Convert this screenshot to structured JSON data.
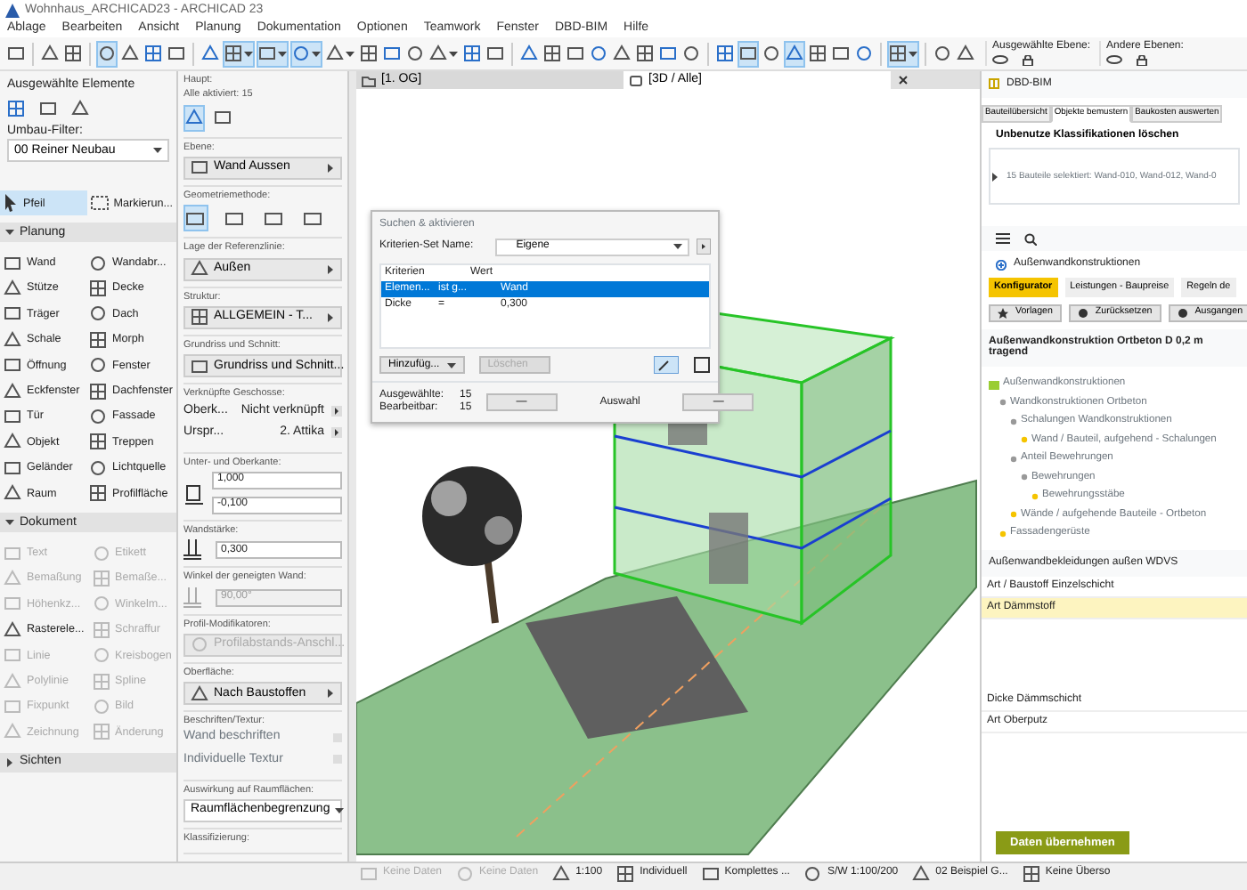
{
  "window": {
    "title": "Wohnhaus_ARCHICAD23 - ARCHICAD 23"
  },
  "menu": [
    "Ablage",
    "Bearbeiten",
    "Ansicht",
    "Planung",
    "Dokumentation",
    "Optionen",
    "Teamwork",
    "Fenster",
    "DBD-BIM",
    "Hilfe"
  ],
  "toolbar": {
    "items": [
      {
        "kind": "button",
        "selected": false
      },
      {
        "kind": "separator"
      },
      {
        "kind": "button",
        "selected": false
      },
      {
        "kind": "button",
        "selected": false
      },
      {
        "kind": "separator"
      },
      {
        "kind": "button",
        "selected": true
      },
      {
        "kind": "button",
        "selected": false
      },
      {
        "kind": "button",
        "selected": false
      },
      {
        "kind": "button",
        "selected": false
      },
      {
        "kind": "separator"
      },
      {
        "kind": "button",
        "selected": false
      },
      {
        "kind": "dropdown",
        "selected": true
      },
      {
        "kind": "dropdown",
        "selected": true
      },
      {
        "kind": "dropdown",
        "selected": true
      },
      {
        "kind": "dropdown",
        "selected": false
      },
      {
        "kind": "button",
        "selected": false
      },
      {
        "kind": "button",
        "selected": false
      },
      {
        "kind": "button",
        "selected": false
      },
      {
        "kind": "dropdown",
        "selected": false
      },
      {
        "kind": "button",
        "selected": false
      },
      {
        "kind": "button",
        "selected": false
      },
      {
        "kind": "separator"
      },
      {
        "kind": "button",
        "selected": false
      },
      {
        "kind": "button",
        "selected": false
      },
      {
        "kind": "button",
        "selected": false
      },
      {
        "kind": "button",
        "selected": false
      },
      {
        "kind": "button",
        "selected": false
      },
      {
        "kind": "button",
        "selected": false
      },
      {
        "kind": "button",
        "selected": false
      },
      {
        "kind": "button",
        "selected": false
      },
      {
        "kind": "separator"
      },
      {
        "kind": "button",
        "selected": false
      },
      {
        "kind": "button",
        "selected": true
      },
      {
        "kind": "button",
        "selected": false
      },
      {
        "kind": "button",
        "selected": true
      },
      {
        "kind": "button",
        "selected": false
      },
      {
        "kind": "button",
        "selected": false
      },
      {
        "kind": "button",
        "selected": false
      },
      {
        "kind": "separator"
      },
      {
        "kind": "dropdown",
        "selected": true
      },
      {
        "kind": "separator"
      },
      {
        "kind": "button",
        "selected": false
      },
      {
        "kind": "button",
        "selected": false
      }
    ],
    "layers": [
      "Ausgewählte Ebene:",
      "Andere Ebenen:"
    ]
  },
  "toolbox": {
    "title": "Ausgewählte Elemente",
    "filter_label": "Umbau-Filter:",
    "filter_value": "00 Reiner Neubau",
    "pointer_tools": [
      {
        "label": "Pfeil",
        "selected": true
      },
      {
        "label": "Markierun...",
        "selected": false
      }
    ],
    "groups": [
      {
        "label": "Planung",
        "expanded": true,
        "tools": [
          {
            "label": "Wand",
            "disabled": false
          },
          {
            "label": "Wandabr...",
            "disabled": false
          },
          {
            "label": "Stütze",
            "disabled": false
          },
          {
            "label": "Decke",
            "disabled": false
          },
          {
            "label": "Träger",
            "disabled": false
          },
          {
            "label": "Dach",
            "disabled": false
          },
          {
            "label": "Schale",
            "disabled": false
          },
          {
            "label": "Morph",
            "disabled": false
          },
          {
            "label": "Öffnung",
            "disabled": false
          },
          {
            "label": "Fenster",
            "disabled": false
          },
          {
            "label": "Eckfenster",
            "disabled": false
          },
          {
            "label": "Dachfenster",
            "disabled": false
          },
          {
            "label": "Tür",
            "disabled": false
          },
          {
            "label": "Fassade",
            "disabled": false
          },
          {
            "label": "Objekt",
            "disabled": false
          },
          {
            "label": "Treppen",
            "disabled": false
          },
          {
            "label": "Geländer",
            "disabled": false
          },
          {
            "label": "Lichtquelle",
            "disabled": false
          },
          {
            "label": "Raum",
            "disabled": false
          },
          {
            "label": "Profilfläche",
            "disabled": false
          }
        ]
      },
      {
        "label": "Dokument",
        "expanded": true,
        "tools": [
          {
            "label": "Text",
            "disabled": true
          },
          {
            "label": "Etikett",
            "disabled": true
          },
          {
            "label": "Bemaßung",
            "disabled": true
          },
          {
            "label": "Bemaße...",
            "disabled": true
          },
          {
            "label": "Höhenkz...",
            "disabled": true
          },
          {
            "label": "Winkelm...",
            "disabled": true
          },
          {
            "label": "Rasterele...",
            "disabled": false
          },
          {
            "label": "Schraffur",
            "disabled": true
          },
          {
            "label": "Linie",
            "disabled": true
          },
          {
            "label": "Kreisbogen",
            "disabled": true
          },
          {
            "label": "Polylinie",
            "disabled": true
          },
          {
            "label": "Spline",
            "disabled": true
          },
          {
            "label": "Fixpunkt",
            "disabled": true
          },
          {
            "label": "Bild",
            "disabled": true
          },
          {
            "label": "Zeichnung",
            "disabled": true
          },
          {
            "label": "Änderung",
            "disabled": true
          }
        ]
      },
      {
        "label": "Sichten",
        "expanded": false
      }
    ]
  },
  "info_box": {
    "header": "Haupt:",
    "selected_count": "Alle aktiviert: 15",
    "sections": [
      {
        "kind": "dropdown",
        "label": "Ebene:",
        "value": "Wand Aussen",
        "disabled": false
      },
      {
        "kind": "icons",
        "label": "Geometriemethode:"
      },
      {
        "kind": "dropdown",
        "label": "Lage der Referenzlinie:",
        "value": "Außen",
        "disabled": false
      },
      {
        "kind": "dropdown",
        "label": "Struktur:",
        "value": "ALLGEMEIN - T...",
        "disabled": false
      },
      {
        "kind": "dropdown",
        "label": "Grundriss und Schnitt:",
        "value": "Grundriss und Schnitt...",
        "disabled": false
      },
      {
        "kind": "pairs",
        "label": "Verknüpfte Geschosse:",
        "rows": [
          {
            "label": "Oberk...",
            "value": "Nicht verknüpft"
          },
          {
            "label": "Urspr...",
            "value": "2. Attika"
          }
        ]
      },
      {
        "kind": "fields",
        "label": "Unter- und Oberkante:",
        "values": [
          "1,000",
          "-0,100"
        ]
      },
      {
        "kind": "field",
        "label": "Wandstärke:",
        "value": "0,300",
        "disabled": false
      },
      {
        "kind": "field",
        "label": "Winkel der geneigten Wand:",
        "value": "90,00°",
        "disabled": true
      },
      {
        "kind": "dropdown",
        "label": "Profil-Modifikatoren:",
        "value": "Profilabstands-Anschl...",
        "disabled": true
      },
      {
        "kind": "dropdown",
        "label": "Oberfläche:",
        "value": "Nach Baustoffen",
        "disabled": false
      },
      {
        "kind": "toggles",
        "label": "Beschriften/Textur:",
        "rows": [
          "Wand beschriften",
          "Individuelle Textur"
        ]
      },
      {
        "kind": "select",
        "label": "Auswirkung auf Raumflächen:",
        "value": "Raumflächenbegrenzung"
      },
      {
        "kind": "heading",
        "label": "Klassifizierung:"
      }
    ]
  },
  "view_tabs": [
    {
      "label": "[1. OG]",
      "selected": false
    },
    {
      "label": "[3D / Alle]",
      "selected": true
    }
  ],
  "dialog": {
    "title": "Suchen & aktivieren",
    "set_label": "Kriterien-Set Name:",
    "set_value": "Eigene",
    "columns": [
      "Kriterien",
      "Wert"
    ],
    "rows": [
      {
        "criterion": "Elemen...",
        "operator": "ist g...",
        "value": "Wand",
        "selected": true
      },
      {
        "criterion": "Dicke",
        "operator": "=",
        "value": "0,300",
        "selected": false
      }
    ],
    "add_button": "Hinzufüg...",
    "delete_button": {
      "label": "Löschen",
      "disabled": true
    },
    "counts": [
      {
        "label": "Ausgewählte:",
        "value": "15"
      },
      {
        "label": "Bearbeitbar:",
        "value": "15"
      }
    ],
    "selection": {
      "minus_left": "—",
      "label": "Auswahl",
      "minus_right": "—"
    }
  },
  "dbd_panel": {
    "title": "DBD-BIM",
    "tabs": [
      {
        "label": "Bauteilübersicht",
        "selected": false
      },
      {
        "label": "Objekte bemustern",
        "selected": true
      },
      {
        "label": "Baukosten auswerten",
        "selected": false
      }
    ],
    "clean_button": "Unbenutze Klassifikationen löschen",
    "selection_row": "15 Bauteile selektiert: Wand-010, Wand-012, Wand-0",
    "category": "Außenwandkonstruktionen",
    "sub_tabs": [
      {
        "label": "Konfigurator",
        "selected": true
      },
      {
        "label": "Leistungen - Baupreise",
        "selected": false
      },
      {
        "label": "Regeln de",
        "selected": false
      }
    ],
    "actions": [
      "Vorlagen",
      "Zurücksetzen",
      "Ausgangen"
    ],
    "heading": "Außenwandkonstruktion Ortbeton D 0,2 m tragend",
    "tree": [
      {
        "label": "Außenwandkonstruktionen",
        "children": [
          {
            "label": "Wandkonstruktionen Ortbeton",
            "children": [
              {
                "label": "Schalungen Wandkonstruktionen",
                "children": [
                  {
                    "label": "Wand / Bauteil, aufgehend - Schalungen"
                  }
                ]
              },
              {
                "label": "Anteil Bewehrungen",
                "children": [
                  {
                    "label": "Bewehrungen",
                    "children": [
                      {
                        "label": "Bewehrungsstäbe"
                      }
                    ]
                  }
                ]
              },
              {
                "label": "Wände / aufgehende Bauteile - Ortbeton"
              }
            ]
          },
          {
            "label": "Fassadengerüste"
          }
        ]
      }
    ],
    "section": "Außenwandbekleidungen außen WDVS",
    "property_groups": [
      [
        {
          "label": "Art / Baustoff Einzelschicht",
          "selected": false
        },
        {
          "label": "Art Dämmstoff",
          "selected": true
        }
      ],
      [
        {
          "label": "Dicke Dämmschicht",
          "selected": false
        },
        {
          "label": "Art Oberputz",
          "selected": false
        }
      ]
    ],
    "submit": "Daten übernehmen"
  },
  "status_bar": [
    {
      "text": "Keine Daten",
      "disabled": true
    },
    {
      "text": "Keine Daten",
      "disabled": true
    },
    {
      "text": "1:100",
      "disabled": false
    },
    {
      "text": "Individuell",
      "disabled": false
    },
    {
      "text": "Komplettes ...",
      "disabled": false
    },
    {
      "text": "S/W 1:100/200",
      "disabled": false
    },
    {
      "text": "02 Beispiel G...",
      "disabled": false
    },
    {
      "text": "Keine Überso",
      "disabled": false
    }
  ]
}
